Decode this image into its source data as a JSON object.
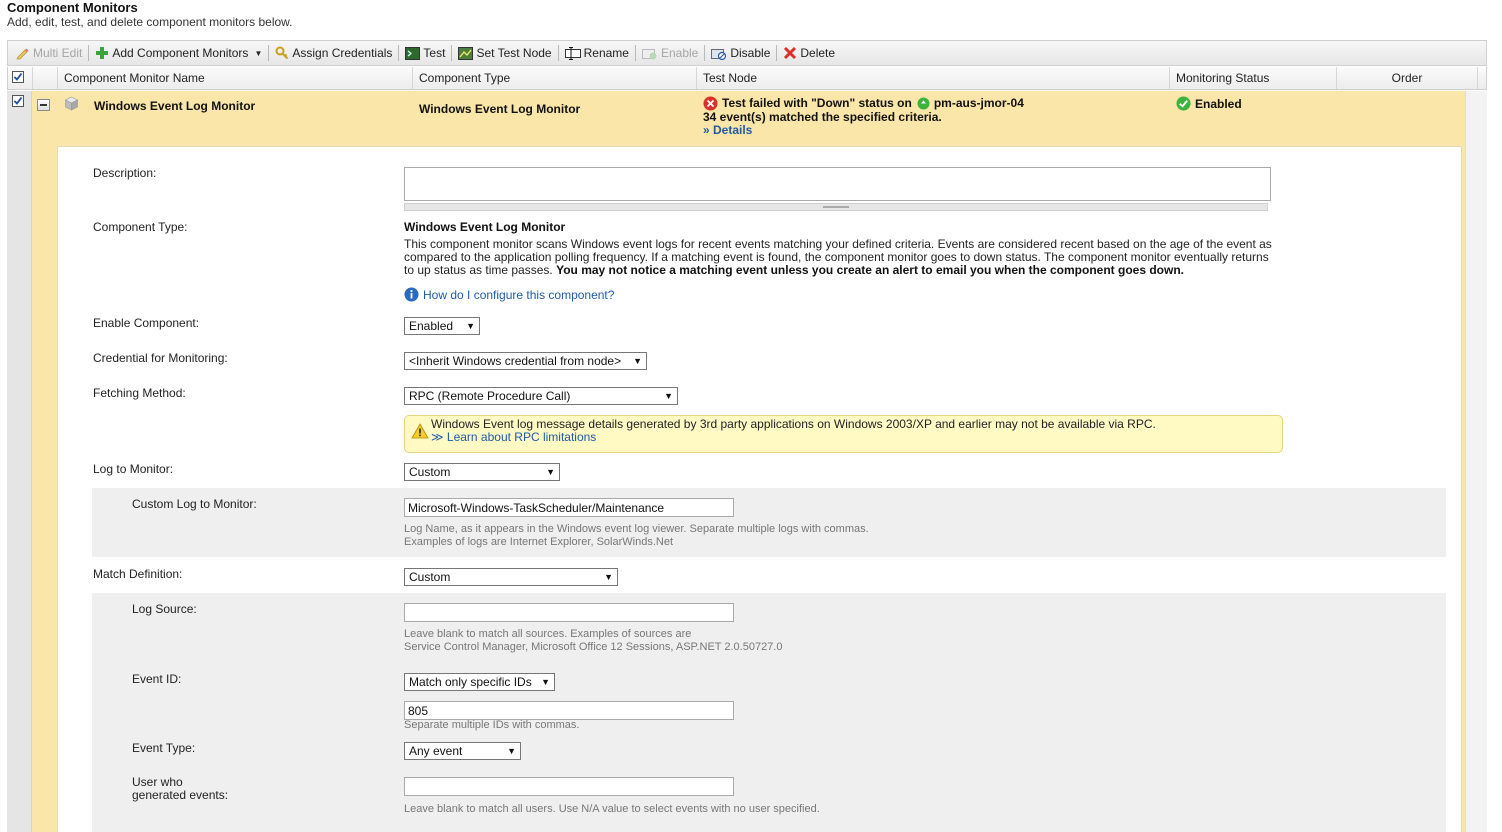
{
  "page": {
    "title": "Component Monitors",
    "subtitle": "Add, edit, test, and delete component monitors below."
  },
  "toolbar": {
    "multi_edit": "Multi Edit",
    "add_component_monitors": "Add Component Monitors",
    "assign_credentials": "Assign Credentials",
    "test": "Test",
    "set_test_node": "Set Test Node",
    "rename": "Rename",
    "enable": "Enable",
    "disable": "Disable",
    "delete": "Delete"
  },
  "grid": {
    "headers": {
      "name": "Component Monitor Name",
      "type": "Component Type",
      "test_node": "Test Node",
      "status": "Monitoring Status",
      "order": "Order"
    },
    "row": {
      "name": "Windows Event Log Monitor",
      "type": "Windows Event Log Monitor",
      "test_result_prefix": "Test failed with \"Down\" status on",
      "test_node_name": "pm-aus-jmor-04",
      "test_result_detail": "34 event(s) matched the specified criteria.",
      "details_link": "» Details",
      "status": "Enabled"
    }
  },
  "form": {
    "description": {
      "label": "Description:",
      "value": ""
    },
    "component_type": {
      "label": "Component Type:",
      "name": "Windows Event Log Monitor",
      "desc_normal": "This component monitor scans Windows event logs for recent events matching your defined criteria. Events are considered recent based on the age of the event as compared to the application polling frequency. If a matching event is found, the component monitor goes to down status. The component monitor eventually returns to up status as time passes.",
      "desc_bold": "You may not notice a matching event unless you create an alert to email you when the component goes down.",
      "help_link": "How do I configure this component?"
    },
    "enable_component": {
      "label": "Enable Component:",
      "value": "Enabled"
    },
    "credential": {
      "label": "Credential for Monitoring:",
      "value": "<Inherit Windows credential from node>"
    },
    "fetching_method": {
      "label": "Fetching Method:",
      "value": "RPC (Remote Procedure Call)",
      "warning": "Windows Event log message details generated by 3rd party applications on Windows 2003/XP and earlier may not be available via RPC.",
      "warning_link": "≫ Learn about RPC limitations"
    },
    "log_to_monitor": {
      "label": "Log to Monitor:",
      "value": "Custom"
    },
    "custom_log": {
      "label": "Custom Log to Monitor:",
      "value": "Microsoft-Windows-TaskScheduler/Maintenance",
      "hint1": "Log Name, as it appears in the Windows event log viewer. Separate multiple logs with commas.",
      "hint2": "Examples of logs are Internet Explorer, SolarWinds.Net"
    },
    "match_definition": {
      "label": "Match Definition:",
      "value": "Custom"
    },
    "log_source": {
      "label": "Log Source:",
      "value": "",
      "hint1": "Leave blank to match all sources. Examples of sources are",
      "hint2": "Service Control Manager, Microsoft Office 12 Sessions, ASP.NET 2.0.50727.0"
    },
    "event_id": {
      "label": "Event ID:",
      "mode": "Match only specific IDs",
      "value": "805",
      "hint": "Separate multiple IDs with commas."
    },
    "event_type": {
      "label": "Event Type:",
      "value": "Any event"
    },
    "user": {
      "label1": "User who",
      "label2": "generated events:",
      "value": "",
      "hint": "Leave blank to match all users. Use N/A value to select events with no user specified."
    }
  },
  "colors": {
    "row_highlight": "#fbe6a9",
    "link": "#1e5aa8",
    "warning_bg": "#fff9c4",
    "error": "#d9302c",
    "ok": "#3db33d"
  }
}
